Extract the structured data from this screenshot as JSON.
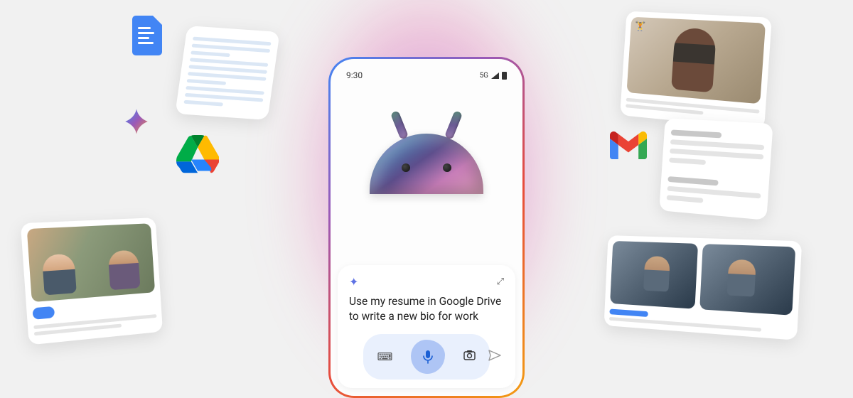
{
  "statusBar": {
    "time": "9:30",
    "network": "5G"
  },
  "prompt": {
    "text": "Use my resume in Google Drive to write a new bio for work"
  },
  "icons": {
    "docs": "docs-icon",
    "drive": "drive-icon",
    "gmail": "gmail-icon",
    "sparkle": "sparkle-icon",
    "keyboard": "keyboard-icon",
    "mic": "mic-icon",
    "camera": "camera-icon",
    "send": "send-icon",
    "expand": "expand-icon"
  }
}
